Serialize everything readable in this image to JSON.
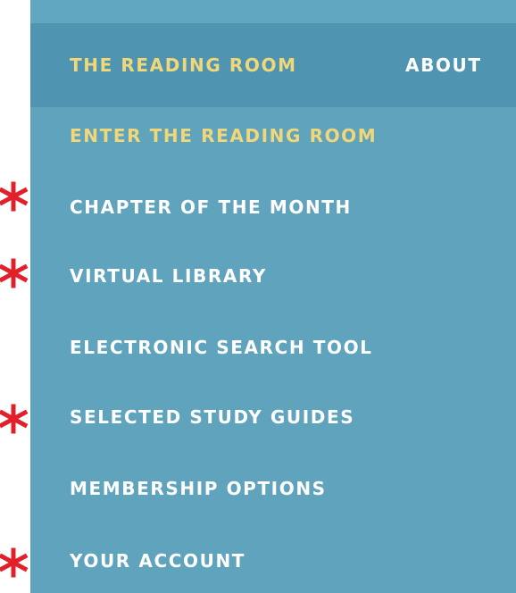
{
  "nav": {
    "active_label": "THE READING ROOM",
    "about_label": "ABOUT"
  },
  "menu": {
    "items": [
      {
        "label": "ENTER THE READING ROOM",
        "highlighted": true,
        "starred": false
      },
      {
        "label": "CHAPTER OF THE MONTH",
        "highlighted": false,
        "starred": true
      },
      {
        "label": "VIRTUAL LIBRARY",
        "highlighted": false,
        "starred": true
      },
      {
        "label": "ELECTRONIC SEARCH TOOL",
        "highlighted": false,
        "starred": false
      },
      {
        "label": "SELECTED STUDY GUIDES",
        "highlighted": false,
        "starred": true
      },
      {
        "label": "MEMBERSHIP OPTIONS",
        "highlighted": false,
        "starred": false
      },
      {
        "label": "YOUR ACCOUNT",
        "highlighted": false,
        "starred": true
      }
    ]
  },
  "colors": {
    "panel": "#5fa3bd",
    "navbar": "#4f94b0",
    "highlight_text": "#f0d77a",
    "menu_text": "#ffffff",
    "star": "#e0212b"
  },
  "icons": {
    "marker": "asterisk-star-icon"
  }
}
